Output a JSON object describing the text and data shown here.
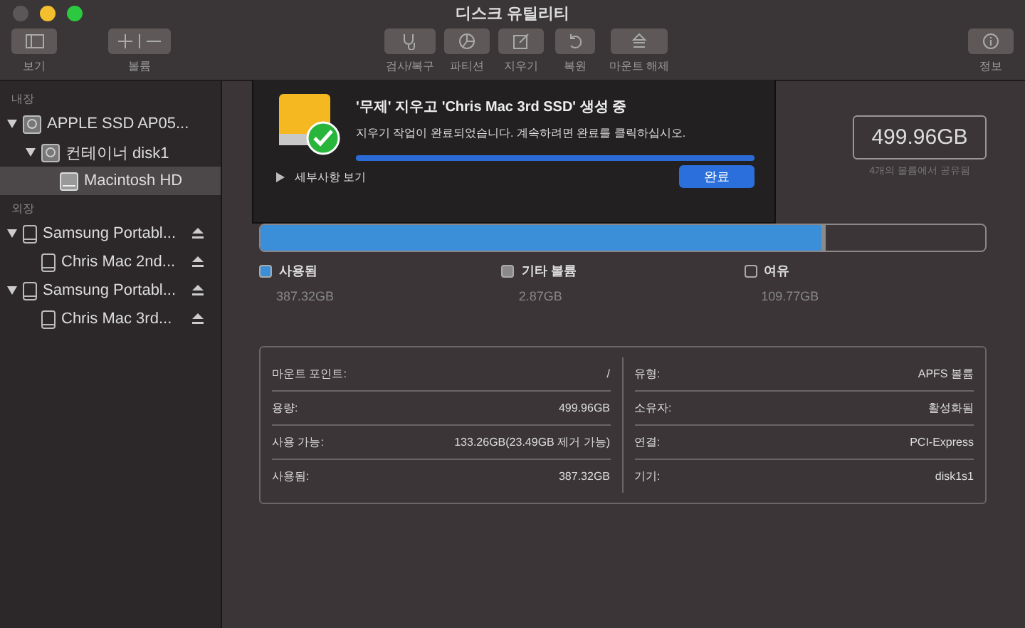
{
  "window": {
    "title": "디스크 유틸리티"
  },
  "toolbar": [
    {
      "kind": "view",
      "label": "보기"
    },
    {
      "kind": "volume",
      "label": "볼륨"
    },
    {
      "kind": "firstaid",
      "label": "검사/복구"
    },
    {
      "kind": "partition",
      "label": "파티션"
    },
    {
      "kind": "erase",
      "label": "지우기"
    },
    {
      "kind": "restore",
      "label": "복원"
    },
    {
      "kind": "unmount",
      "label": "마운트 해제"
    },
    {
      "kind": "info",
      "label": "정보"
    }
  ],
  "sidebar": {
    "sections": [
      {
        "title": "내장",
        "items": [
          {
            "label": "APPLE SSD AP05...",
            "kind": "disk",
            "expanded": true,
            "eject": false,
            "selected": false,
            "children": [
              {
                "label": "컨테이너 disk1",
                "kind": "disk",
                "expanded": true,
                "eject": false,
                "selected": false,
                "children": [
                  {
                    "label": "Macintosh HD",
                    "kind": "volume",
                    "eject": false,
                    "selected": true
                  }
                ]
              }
            ]
          }
        ]
      },
      {
        "title": "외장",
        "items": [
          {
            "label": "Samsung Portabl...",
            "kind": "external",
            "expanded": true,
            "eject": true,
            "selected": false,
            "children": [
              {
                "label": "Chris Mac 2nd...",
                "kind": "external",
                "eject": true,
                "selected": false
              }
            ]
          },
          {
            "label": "Samsung Portabl...",
            "kind": "external",
            "expanded": true,
            "eject": true,
            "selected": false,
            "children": [
              {
                "label": "Chris Mac 3rd...",
                "kind": "external",
                "eject": true,
                "selected": false
              }
            ]
          }
        ]
      }
    ]
  },
  "dialog": {
    "title": "'무제' 지우고 'Chris Mac 3rd SSD' 생성 중",
    "message": "지우기 작업이 완료되었습니다. 계속하려면 완료를 클릭하십시오.",
    "level": 1,
    "details": "세부사항 보기",
    "button": "완료"
  },
  "capacity": {
    "value": "499.96GB",
    "caption": "4개의 볼륨에서 공유됨"
  },
  "usage": [
    {
      "label": "사용됨",
      "value": "387.32GB",
      "level": 0.775,
      "color": "#3b8ed8"
    },
    {
      "label": "기타 볼륨",
      "value": "2.87GB",
      "level": 0.005,
      "color": "#8a8a8a"
    },
    {
      "label": "여유",
      "value": "109.77GB",
      "level": 0.22,
      "color": "#3b3537"
    }
  ],
  "info": {
    "left": [
      {
        "label": "마운트 포인트:",
        "value": "/"
      },
      {
        "label": "용량:",
        "value": "499.96GB"
      },
      {
        "label": "사용 가능:",
        "value": "133.26GB(23.49GB 제거 가능)"
      },
      {
        "label": "사용됨:",
        "value": "387.32GB"
      }
    ],
    "right": [
      {
        "label": "유형:",
        "value": "APFS 볼륨"
      },
      {
        "label": "소유자:",
        "value": "활성화됨"
      },
      {
        "label": "연결:",
        "value": "PCI-Express"
      },
      {
        "label": "기기:",
        "value": "disk1s1"
      }
    ]
  }
}
